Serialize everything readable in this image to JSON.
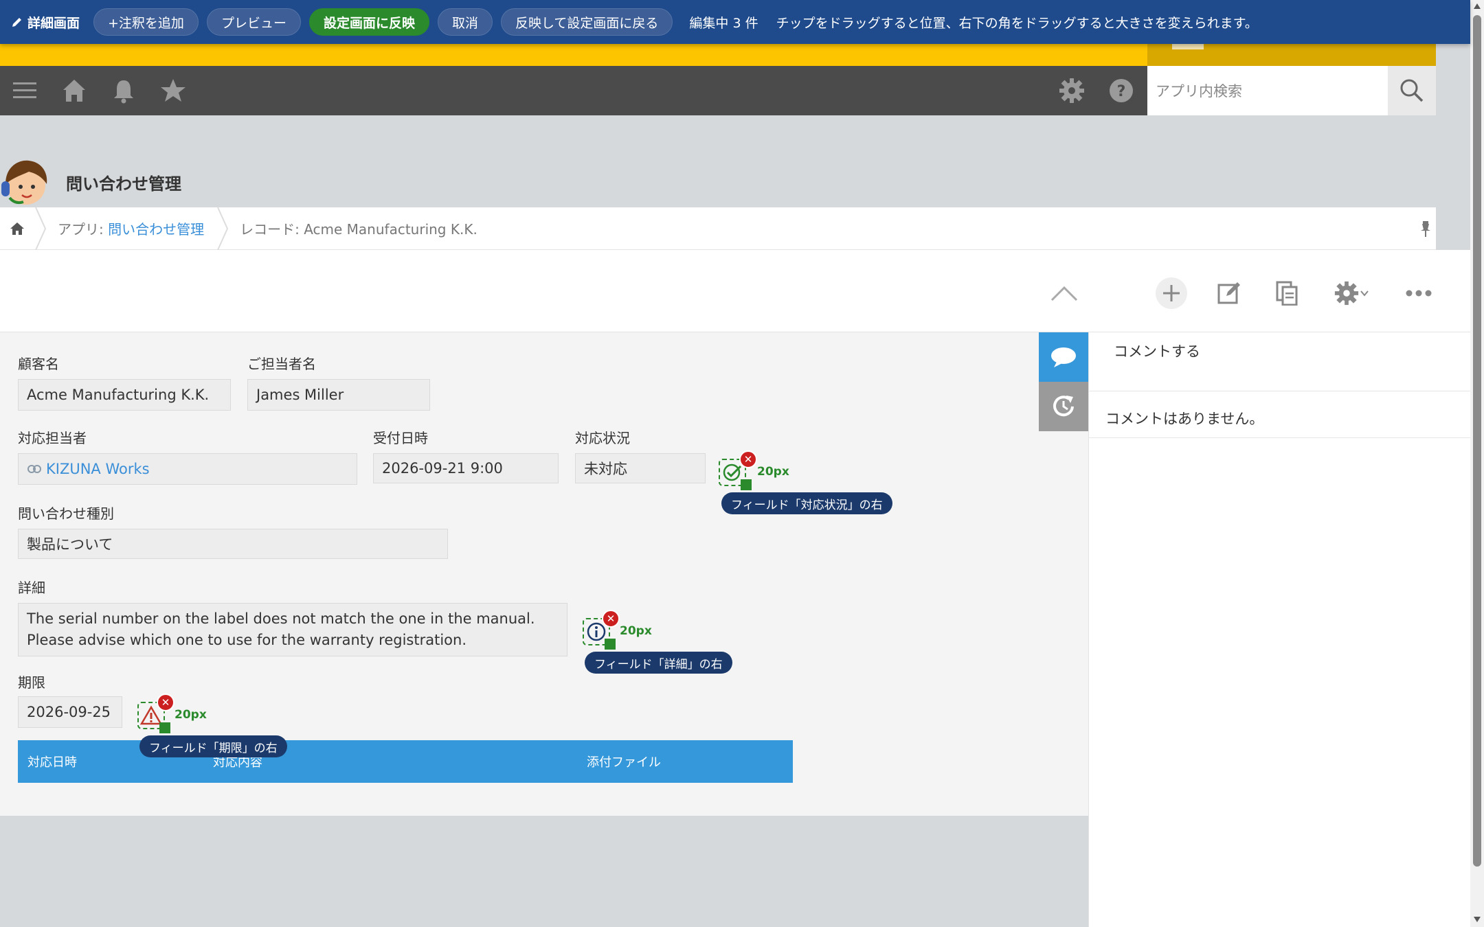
{
  "editor_bar": {
    "title": "詳細画面",
    "add_annotation": "+注釈を追加",
    "preview": "プレビュー",
    "apply": "設定画面に反映",
    "cancel": "取消",
    "apply_return": "反映して設定画面に戻る",
    "editing_count": "編集中 3 件",
    "hint": "チップをドラッグすると位置、右下の角をドラッグすると大きさを変えられます。"
  },
  "header": {
    "search_placeholder": "アプリ内検索",
    "icons": [
      "menu-icon",
      "home-icon",
      "bell-icon",
      "star-icon",
      "gear-icon",
      "help-icon",
      "search-icon"
    ]
  },
  "app": {
    "title": "問い合わせ管理"
  },
  "breadcrumb": {
    "app_prefix": "アプリ: ",
    "app_link": "問い合わせ管理",
    "record": "レコード: Acme Manufacturing K.K."
  },
  "fields": {
    "customer_label": "顧客名",
    "customer_value": "Acme Manufacturing K.K.",
    "contact_label": "ご担当者名",
    "contact_value": "James Miller",
    "assignee_label": "対応担当者",
    "assignee_value": "KIZUNA Works",
    "received_label": "受付日時",
    "received_value": "2026-09-21 9:00",
    "status_label": "対応状況",
    "status_value": "未対応",
    "category_label": "問い合わせ種別",
    "category_value": "製品について",
    "detail_label": "詳細",
    "detail_line1": "The serial number on the label does not match the one in the manual.",
    "detail_line2": "Please advise which one to use for the warranty registration.",
    "deadline_label": "期限",
    "deadline_value": "2026-09-25"
  },
  "subtable": {
    "headers": [
      "対応日時",
      "対応内容",
      "添付ファイル"
    ]
  },
  "annotations": [
    {
      "size": "20px",
      "tooltip": "フィールド「対応状況」の右",
      "icon": "check-circle-icon",
      "close": "✕"
    },
    {
      "size": "20px",
      "tooltip": "フィールド「詳細」の右",
      "icon": "info-circle-icon",
      "close": "✕"
    },
    {
      "size": "20px",
      "tooltip": "フィールド「期限」の右",
      "icon": "warning-triangle-icon",
      "close": "✕"
    }
  ],
  "comments": {
    "input_placeholder": "コメントする",
    "empty": "コメントはありません。"
  },
  "colors": {
    "editor_bar": "#1f4b8c",
    "accent_green": "#2a8a2c",
    "header": "#4b4b4b",
    "yellow": "#fdc500",
    "link": "#3a8fd8",
    "subtable_header": "#3598db",
    "close_red": "#cc1f1f"
  }
}
